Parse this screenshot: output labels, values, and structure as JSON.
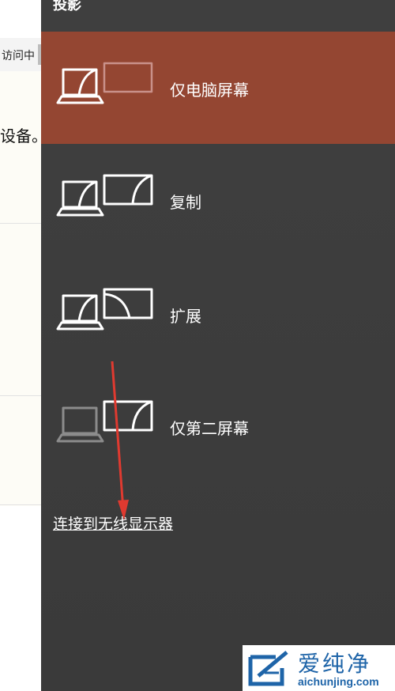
{
  "background_page": {
    "tab_text": "访问中",
    "body_text": "设备。"
  },
  "panel": {
    "title": "投影",
    "options": [
      {
        "label": "仅电脑屏幕",
        "selected": true
      },
      {
        "label": "复制",
        "selected": false
      },
      {
        "label": "扩展",
        "selected": false
      },
      {
        "label": "仅第二屏幕",
        "selected": false
      }
    ],
    "wireless_link": "连接到无线显示器"
  },
  "watermark": {
    "brand_cn": "爱纯净",
    "brand_url": "aichunjing.com"
  },
  "colors": {
    "panel_bg": "#3f3f3f",
    "selected_bg": "#944632",
    "arrow": "#e03a30",
    "watermark": "#1e64a8"
  }
}
